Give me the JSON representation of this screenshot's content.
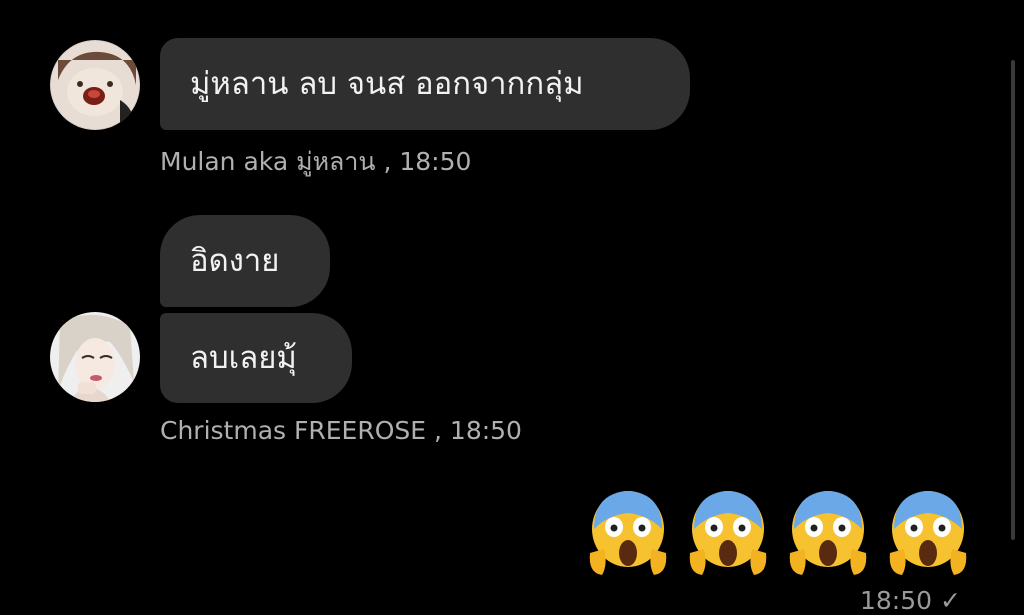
{
  "colors": {
    "background": "#000000",
    "bubble": "#2f2f2f",
    "text": "#f2f2f2",
    "meta": "#b0b0b0"
  },
  "messages": [
    {
      "sender_name": "Mulan aka มู่หลาน",
      "time": "18:50",
      "bubbles": [
        "มู่หลาน ลบ จนส ออกจากกลุ่ม"
      ]
    },
    {
      "sender_name": "Christmas FREEROSE",
      "time": "18:50",
      "bubbles": [
        "อิดงาย",
        "ลบเลยมุ้"
      ]
    }
  ],
  "outgoing": {
    "emojis": [
      "face-screaming-in-fear",
      "face-screaming-in-fear",
      "face-screaming-in-fear",
      "face-screaming-in-fear"
    ],
    "time": "18:50",
    "status_icon": "check-icon"
  }
}
